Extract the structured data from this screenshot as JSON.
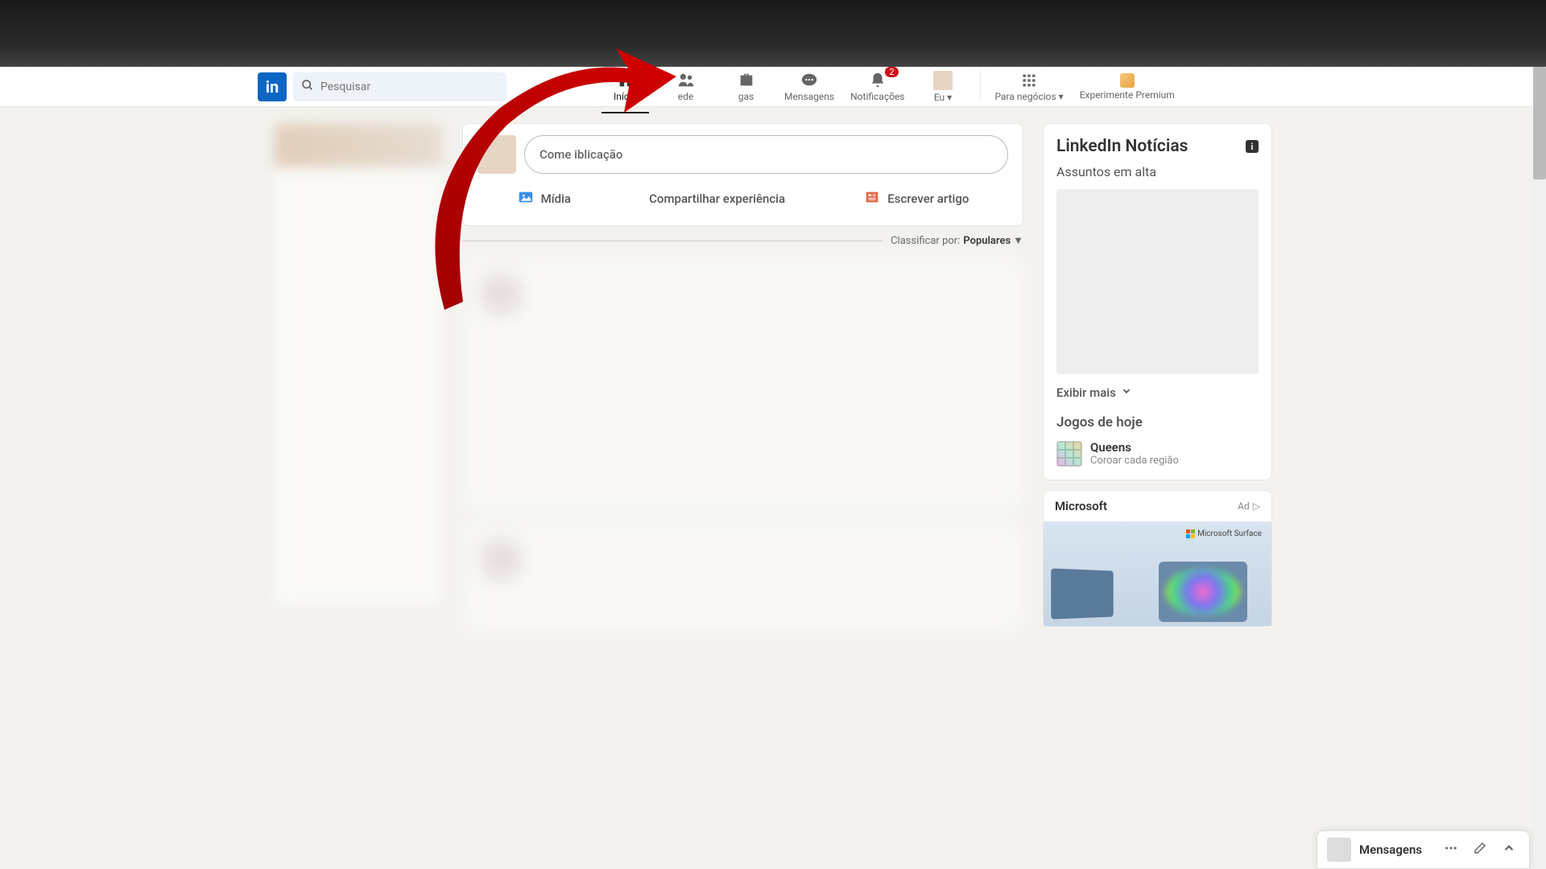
{
  "search": {
    "placeholder": "Pesquisar"
  },
  "nav": {
    "home": "Início",
    "network": "ede",
    "jobs": "gas",
    "messaging": "Mensagens",
    "notifications": "Notificações",
    "notifications_badge": "2",
    "me": "Eu",
    "business": "Para negócios",
    "premium": "Experimente Premium"
  },
  "post_box": {
    "placeholder": "Come           iblicação",
    "media": "Mídia",
    "experience": "Compartilhar experiência",
    "article": "Escrever artigo"
  },
  "sort": {
    "label": "Classificar por:",
    "value": "Populares"
  },
  "news": {
    "title": "LinkedIn Notícias",
    "subtitle": "Assuntos em alta",
    "show_more": "Exibir mais"
  },
  "games": {
    "title": "Jogos de hoje",
    "queens": {
      "name": "Queens",
      "desc": "Coroar cada região"
    }
  },
  "ad": {
    "brand": "Microsoft",
    "label": "Ad",
    "surface": "Microsoft Surface"
  },
  "msg_dock": {
    "title": "Mensagens"
  }
}
